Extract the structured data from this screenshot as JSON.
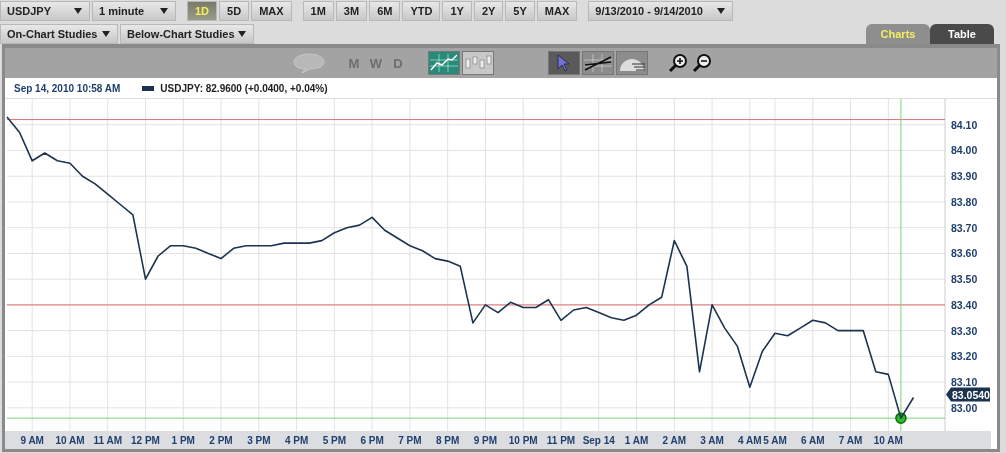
{
  "controls": {
    "symbol": "USDJPY",
    "interval": "1 minute",
    "range_groups": [
      [
        {
          "label": "1D",
          "selected": true
        },
        {
          "label": "5D",
          "selected": false
        },
        {
          "label": "MAX",
          "selected": false
        }
      ],
      [
        {
          "label": "1M",
          "selected": false
        },
        {
          "label": "3M",
          "selected": false
        },
        {
          "label": "6M",
          "selected": false
        },
        {
          "label": "YTD",
          "selected": false
        },
        {
          "label": "1Y",
          "selected": false
        },
        {
          "label": "2Y",
          "selected": false
        },
        {
          "label": "5Y",
          "selected": false
        },
        {
          "label": "MAX",
          "selected": false
        }
      ]
    ],
    "date_range": "9/13/2010 - 9/14/2010",
    "studies": [
      "On-Chart Studies",
      "Below-Chart Studies"
    ]
  },
  "tabs": [
    {
      "label": "Charts",
      "selected": true
    },
    {
      "label": "Table",
      "selected": false
    }
  ],
  "toolbar": {
    "periods": [
      {
        "label": "M",
        "disabled": true
      },
      {
        "label": "W",
        "disabled": true
      },
      {
        "label": "D",
        "disabled": true
      }
    ],
    "chart_types": [
      {
        "kind": "line",
        "selected": true
      },
      {
        "kind": "candlestick",
        "selected": false
      }
    ],
    "tools": [
      {
        "kind": "pointer",
        "selected": true
      },
      {
        "kind": "trendline",
        "selected": false
      },
      {
        "kind": "notes",
        "selected": false
      }
    ]
  },
  "legend": {
    "timestamp": "Sep 14, 2010 10:58 AM",
    "quote": "USDJPY: 82.9600 (+0.0400, +0.04%)"
  },
  "chart": {
    "last_price": "83.0540",
    "chart_data": {
      "type": "line",
      "ylim": [
        82.91,
        84.2
      ],
      "categories": [
        null,
        null,
        "9 AM",
        null,
        null,
        "10 AM",
        null,
        null,
        "11 AM",
        null,
        null,
        "12 PM",
        null,
        null,
        "1 PM",
        null,
        null,
        "2 PM",
        null,
        null,
        "3 PM",
        null,
        null,
        "4 PM",
        null,
        null,
        "5 PM",
        null,
        null,
        "6 PM",
        null,
        null,
        "7 PM",
        null,
        null,
        "8 PM",
        null,
        null,
        "9 PM",
        null,
        null,
        "10 PM",
        null,
        null,
        "11 PM",
        null,
        null,
        "Sep 14",
        null,
        null,
        "1 AM",
        null,
        null,
        "2 AM",
        null,
        null,
        "3 AM",
        null,
        null,
        "4 AM",
        null,
        "5 AM",
        null,
        null,
        "6 AM",
        null,
        null,
        "7 AM",
        null,
        null,
        "10 AM",
        null,
        null
      ],
      "yticks": [
        {
          "value": 83.0,
          "label": "83.00"
        },
        {
          "value": 83.1,
          "label": "83.10"
        },
        {
          "value": 83.2,
          "label": "83.20"
        },
        {
          "value": 83.3,
          "label": "83.30"
        },
        {
          "value": 83.4,
          "label": "83.40"
        },
        {
          "value": 83.5,
          "label": "83.50"
        },
        {
          "value": 83.6,
          "label": "83.60"
        },
        {
          "value": 83.7,
          "label": "83.70"
        },
        {
          "value": 83.8,
          "label": "83.80"
        },
        {
          "value": 83.9,
          "label": "83.90"
        },
        {
          "value": 84.0,
          "label": "84.00"
        },
        {
          "value": 84.1,
          "label": "84.10"
        }
      ],
      "grid": true,
      "series": [
        {
          "color": "#1c3350",
          "values": [
            84.13,
            84.07,
            83.96,
            83.99,
            83.96,
            83.95,
            83.9,
            83.87,
            83.83,
            83.79,
            83.75,
            83.5,
            83.59,
            83.63,
            83.63,
            83.62,
            83.6,
            83.58,
            83.62,
            83.63,
            83.63,
            83.63,
            83.64,
            83.64,
            83.64,
            83.65,
            83.68,
            83.7,
            83.71,
            83.74,
            83.69,
            83.66,
            83.63,
            83.61,
            83.58,
            83.57,
            83.55,
            83.33,
            83.4,
            83.37,
            83.41,
            83.39,
            83.39,
            83.42,
            83.34,
            83.38,
            83.39,
            83.37,
            83.35,
            83.34,
            83.36,
            83.4,
            83.43,
            83.65,
            83.55,
            83.14,
            83.4,
            83.31,
            83.24,
            83.08,
            83.22,
            83.29,
            83.28,
            83.31,
            83.34,
            83.33,
            83.3,
            83.3,
            83.3,
            83.14,
            83.13,
            82.96,
            83.04
          ]
        }
      ],
      "ref_lines": [
        {
          "axis": "y",
          "value": 84.12
        },
        {
          "axis": "y",
          "value": 83.4
        }
      ]
    }
  }
}
